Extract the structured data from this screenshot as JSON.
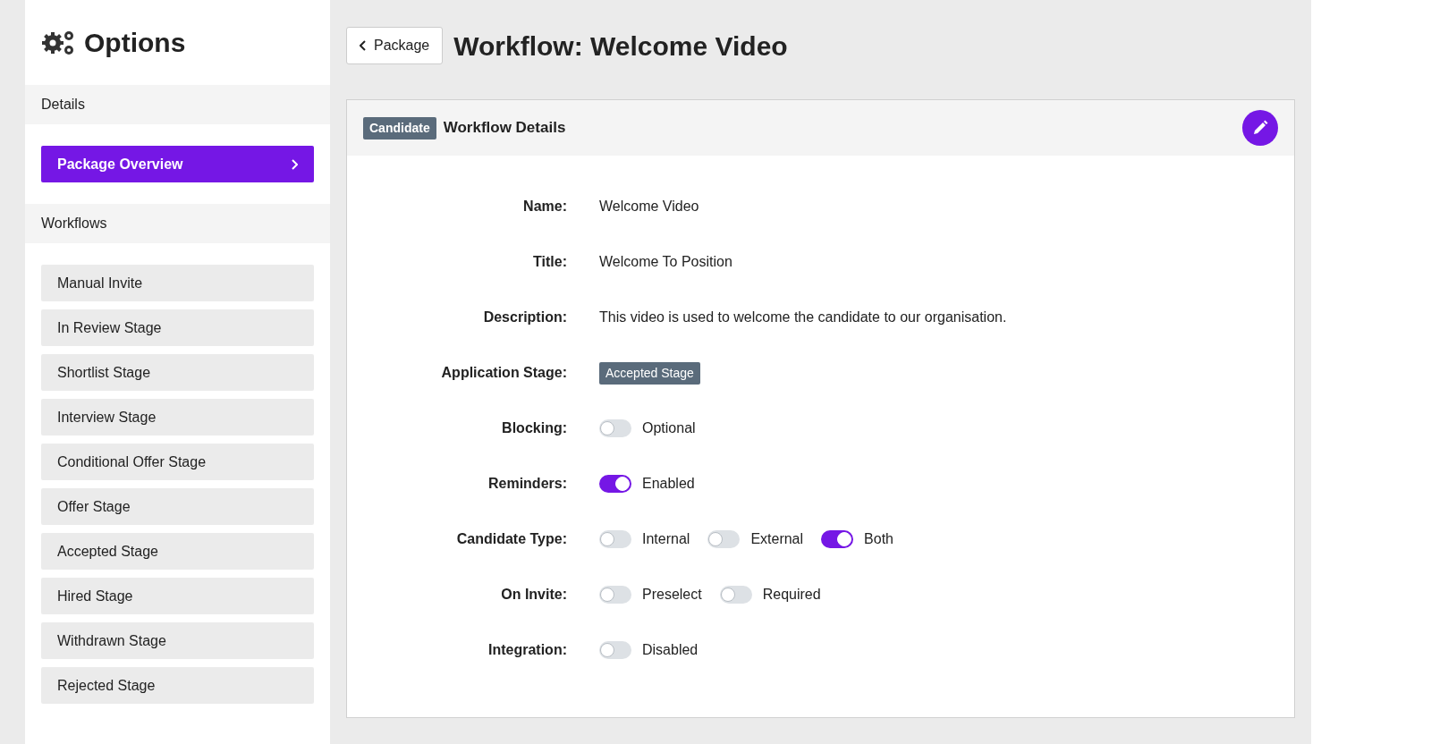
{
  "sidebar": {
    "title": "Options",
    "sections": [
      {
        "heading": "Details",
        "items": [
          {
            "label": "Package Overview",
            "selected": true
          }
        ]
      },
      {
        "heading": "Workflows",
        "items": [
          {
            "label": "Manual Invite",
            "selected": false
          },
          {
            "label": "In Review Stage",
            "selected": false
          },
          {
            "label": "Shortlist Stage",
            "selected": false
          },
          {
            "label": "Interview Stage",
            "selected": false
          },
          {
            "label": "Conditional Offer Stage",
            "selected": false
          },
          {
            "label": "Offer Stage",
            "selected": false
          },
          {
            "label": "Accepted Stage",
            "selected": false
          },
          {
            "label": "Hired Stage",
            "selected": false
          },
          {
            "label": "Withdrawn Stage",
            "selected": false
          },
          {
            "label": "Rejected Stage",
            "selected": false
          }
        ]
      }
    ]
  },
  "header": {
    "back_button": "Package",
    "title": "Workflow: Welcome Video"
  },
  "card": {
    "badge": "Candidate",
    "title": "Workflow Details",
    "fields": [
      {
        "label": "Name:",
        "kind": "text",
        "value": "Welcome Video"
      },
      {
        "label": "Title:",
        "kind": "text",
        "value": "Welcome To Position"
      },
      {
        "label": "Description:",
        "kind": "text",
        "value": "This video is used to welcome the candidate to our organisation."
      },
      {
        "label": "Application Stage:",
        "kind": "badge",
        "value": "Accepted Stage"
      },
      {
        "label": "Blocking:",
        "kind": "toggles",
        "toggles": [
          {
            "label": "Optional",
            "on": false
          }
        ]
      },
      {
        "label": "Reminders:",
        "kind": "toggles",
        "toggles": [
          {
            "label": "Enabled",
            "on": true
          }
        ]
      },
      {
        "label": "Candidate Type:",
        "kind": "toggles",
        "toggles": [
          {
            "label": "Internal",
            "on": false
          },
          {
            "label": "External",
            "on": false
          },
          {
            "label": "Both",
            "on": true
          }
        ]
      },
      {
        "label": "On Invite:",
        "kind": "toggles",
        "toggles": [
          {
            "label": "Preselect",
            "on": false
          },
          {
            "label": "Required",
            "on": false
          }
        ]
      },
      {
        "label": "Integration:",
        "kind": "toggles",
        "toggles": [
          {
            "label": "Disabled",
            "on": false
          }
        ]
      }
    ]
  }
}
